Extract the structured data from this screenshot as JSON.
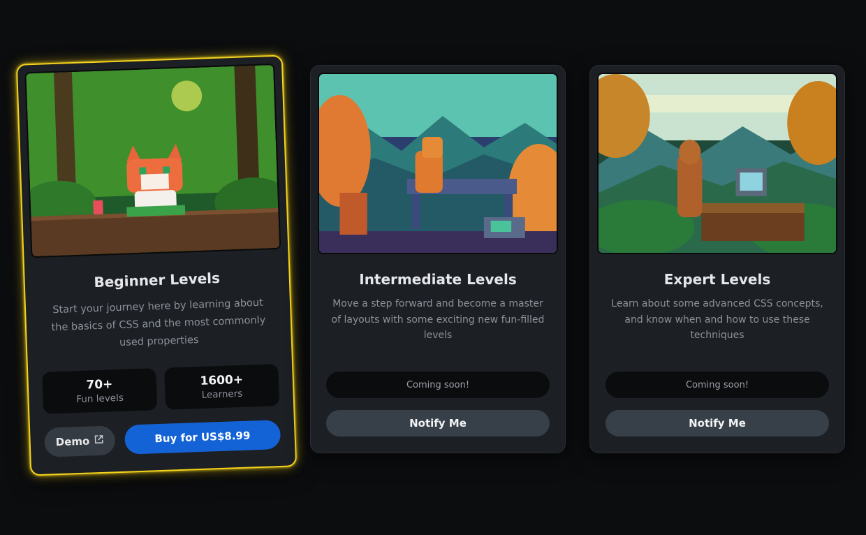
{
  "cards": [
    {
      "title": "Beginner Levels",
      "description": "Start your journey here by learning about the basics of CSS and the most commonly used properties",
      "stats": [
        {
          "value": "70+",
          "label": "Fun levels"
        },
        {
          "value": "1600+",
          "label": "Learners"
        }
      ],
      "demo_label": "Demo",
      "demo_icon": "external-link-icon",
      "buy_label": "Buy for US$8.99",
      "highlight_color": "#f3d21c"
    },
    {
      "title": "Intermediate Levels",
      "description": "Move a step forward and become a master of layouts with some exciting new fun-filled levels",
      "status": "Coming soon!",
      "notify_label": "Notify Me"
    },
    {
      "title": "Expert Levels",
      "description": "Learn about some advanced CSS concepts, and know when and how to use these techniques",
      "status": "Coming soon!",
      "notify_label": "Notify Me"
    }
  ],
  "colors": {
    "background": "#0c0d0f",
    "card": "#1c1f24",
    "buy_button": "#1463d6",
    "notify_button": "#374048"
  }
}
